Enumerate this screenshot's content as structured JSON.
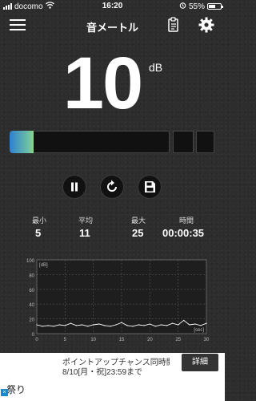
{
  "status_bar": {
    "carrier": "docomo",
    "time": "16:20",
    "battery": "55%"
  },
  "nav": {
    "title": "音メートル"
  },
  "reading": {
    "value": "10",
    "unit": "dB",
    "level_fraction": 0.15
  },
  "stats": [
    {
      "label": "最小",
      "value": "5"
    },
    {
      "label": "平均",
      "value": "11"
    },
    {
      "label": "最大",
      "value": "25"
    },
    {
      "label": "時間",
      "value": "00:00:35"
    }
  ],
  "chart_data": {
    "type": "line",
    "ylabel": "dB",
    "xlabel": "sec",
    "xlim": [
      0,
      30
    ],
    "ylim": [
      0,
      100
    ],
    "x_ticks": [
      "0",
      "5",
      "10",
      "15",
      "20",
      "25",
      "30"
    ],
    "y_ticks": [
      "0",
      "20",
      "40",
      "60",
      "80",
      "100"
    ],
    "grid": true,
    "x": [
      0,
      1,
      2,
      3,
      4,
      5,
      6,
      7,
      8,
      9,
      10,
      11,
      12,
      13,
      14,
      15,
      16,
      17,
      18,
      19,
      20,
      21,
      22,
      23,
      24,
      25,
      26,
      27,
      28,
      29,
      30
    ],
    "values": [
      12,
      10,
      11,
      10,
      12,
      11,
      14,
      11,
      12,
      10,
      12,
      13,
      11,
      10,
      12,
      15,
      11,
      10,
      12,
      11,
      13,
      10,
      12,
      11,
      14,
      12,
      18,
      12,
      13,
      11,
      14
    ]
  },
  "ad": {
    "line1": "ポイントアップチャンス同時開催",
    "line2": "8/10[月・祝]23:59まで",
    "left_text": "祭り",
    "button": "詳細",
    "close": "×"
  },
  "colors": {
    "meter_start": "#2f7fd0",
    "meter_end": "#8ed48a",
    "background": "#2d2d2d"
  }
}
